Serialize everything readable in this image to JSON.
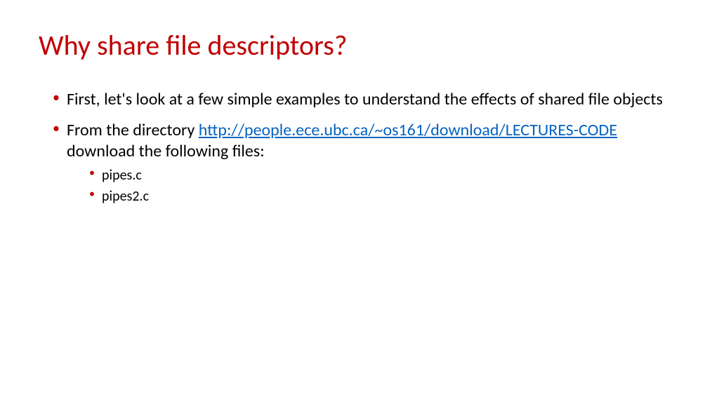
{
  "title": "Why share file descriptors?",
  "bullets": {
    "b1": "First, let's look at a few simple examples to understand the effects of shared file objects",
    "b2_pre": "From the directory ",
    "b2_link": "http://people.ece.ubc.ca/~os161/download/LECTURES-CODE",
    "b2_post": " download the following files:",
    "sub1": "pipes.c",
    "sub2": "pipes2.c"
  }
}
